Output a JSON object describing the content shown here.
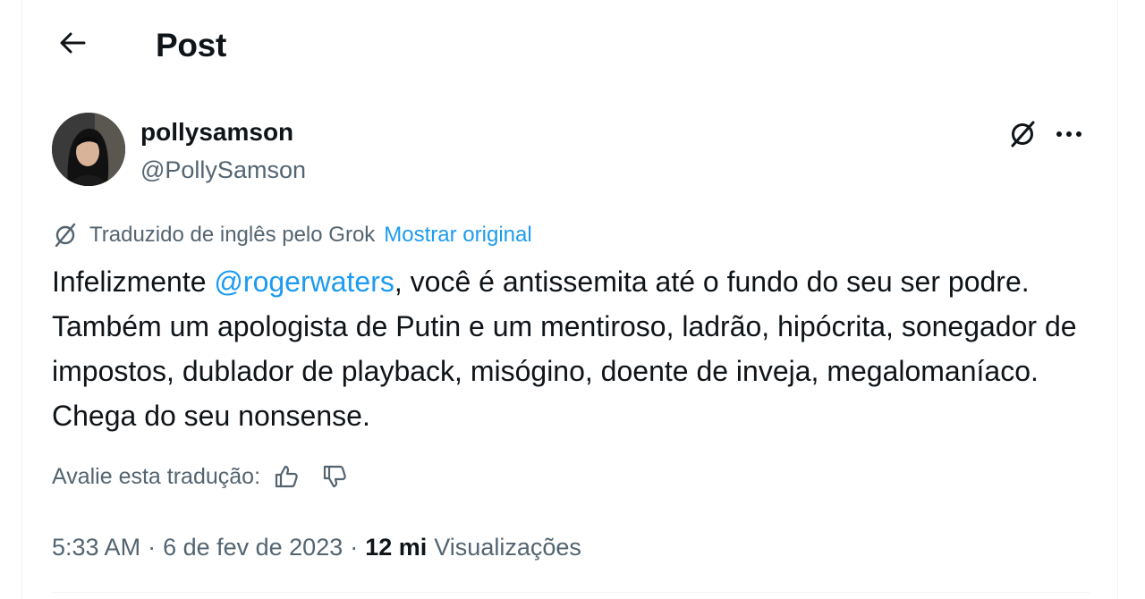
{
  "header": {
    "title": "Post",
    "back_icon": "arrow-left-icon"
  },
  "author": {
    "display_name": "pollysamson",
    "handle": "@PollySamson",
    "avatar_icon": "avatar-photo"
  },
  "actions": {
    "grok_icon": "grok-icon",
    "more_icon": "more-horizontal-icon"
  },
  "translation": {
    "note": "Traduzido de inglês pelo Grok",
    "show_original": "Mostrar original"
  },
  "tweet": {
    "text_before": "Infelizmente ",
    "mention": "@rogerwaters",
    "text_after": ", você é antissemita até o fundo do seu ser podre. Também um apologista de Putin e um mentiroso, ladrão, hipócrita, sonegador de impostos, dublador de playback, misógino, doente de inveja, megalomaníaco. Chega do seu nonsense."
  },
  "rating": {
    "label": "Avalie esta tradução:",
    "up_icon": "thumbs-up-icon",
    "down_icon": "thumbs-down-icon"
  },
  "meta": {
    "time": "5:33 AM",
    "separator": "·",
    "date": "6 de fev de 2023",
    "views_count": "12 mi",
    "views_label": "Visualizações"
  },
  "colors": {
    "accent": "#1d9bf0",
    "text": "#0f1419",
    "secondary": "#536471",
    "border": "#eff3f4"
  }
}
